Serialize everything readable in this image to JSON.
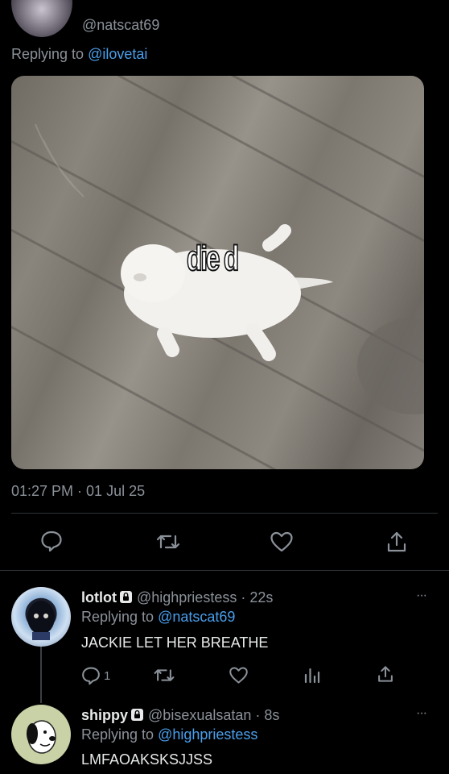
{
  "top_tweet": {
    "handle": "@natscat69",
    "replying_prefix": "Replying to",
    "replying_handle": "@ilovetai",
    "media_caption": "die d",
    "timestamp": "01:27 PM · 01 Jul 25",
    "actions": [
      "reply-icon",
      "retweet-icon",
      "like-icon",
      "share-icon"
    ]
  },
  "replies": [
    {
      "name": "lotlot",
      "handle": "@highpriestess",
      "time": "· 22s",
      "replying_prefix": "Replying to",
      "replying_handle": "@natscat69",
      "text": "JACKIE LET HER BREATHE",
      "reply_count": "1",
      "more": "···"
    },
    {
      "name": "shippy",
      "handle": "@bisexualsatan",
      "time": "· 8s",
      "replying_prefix": "Replying to",
      "replying_handle": "@highpriestess",
      "text": "LMFAOAKSKSJJSS",
      "more": "···"
    }
  ],
  "colors": {
    "background": "#000000",
    "link": "#4a9eeb",
    "muted": "#8b9199",
    "divider": "#2f3336"
  }
}
